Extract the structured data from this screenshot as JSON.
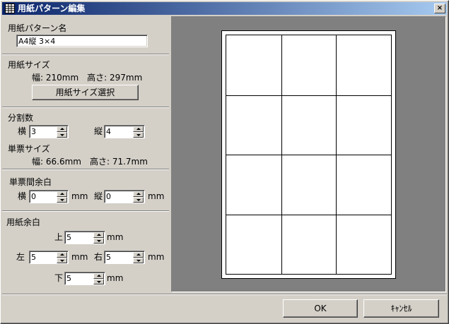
{
  "window": {
    "title": "用紙パターン編集",
    "close_label": "×"
  },
  "pattern_name": {
    "label": "用紙パターン名",
    "value": "A4縦 3×4"
  },
  "paper_size": {
    "label": "用紙サイズ",
    "info": "幅: 210mm　高さ: 297mm",
    "select_button": "用紙サイズ選択"
  },
  "division": {
    "label": "分割数",
    "horizontal_label": "横",
    "horizontal_value": "3",
    "vertical_label": "縦",
    "vertical_value": "4",
    "cell_size_label": "単票サイズ",
    "cell_size_info": "幅: 66.6mm　高さ: 71.7mm"
  },
  "cell_gap": {
    "label": "単票間余白",
    "horizontal_label": "横",
    "horizontal_value": "0",
    "vertical_label": "縦",
    "vertical_value": "0",
    "unit": "mm"
  },
  "paper_margin": {
    "label": "用紙余白",
    "top_label": "上",
    "top_value": "5",
    "left_label": "左",
    "left_value": "5",
    "right_label": "右",
    "right_value": "5",
    "bottom_label": "下",
    "bottom_value": "5",
    "unit": "mm"
  },
  "preview": {
    "columns": 3,
    "rows": 4
  },
  "footer": {
    "ok_label": "OK",
    "cancel_label": "ｷｬﾝｾﾙ"
  },
  "colors": {
    "titlebar_start": "#0a246a",
    "titlebar_end": "#a6caf0",
    "dialog_bg": "#d4d0c8",
    "preview_bg": "#808080"
  }
}
